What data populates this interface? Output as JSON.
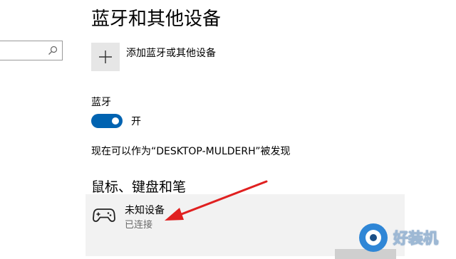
{
  "search": {
    "value": "",
    "placeholder": ""
  },
  "page": {
    "title": "蓝牙和其他设备"
  },
  "add_device": {
    "label": "添加蓝牙或其他设备"
  },
  "bluetooth": {
    "heading": "蓝牙",
    "toggle_state_label": "开",
    "toggle_on": true,
    "accent_color": "#0063b1",
    "discoverable_text": "现在可以作为“DESKTOP-MULDERH”被发现"
  },
  "mouse_section": {
    "heading": "鼠标、键盘和笔",
    "devices": [
      {
        "name": "未知设备",
        "status": "已连接",
        "icon": "gamepad-icon"
      }
    ]
  },
  "annotation": {
    "arrow_color": "#e02020"
  },
  "watermark": {
    "text": "好装机"
  }
}
